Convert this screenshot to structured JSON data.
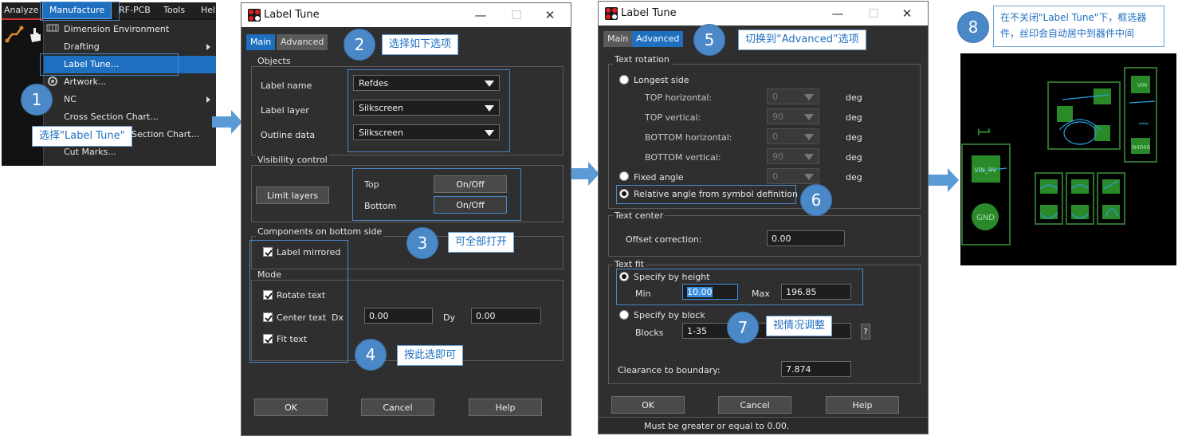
{
  "menu": {
    "bar": [
      "Analyze",
      "Manufacture",
      "RF-PCB",
      "Tools",
      "Help"
    ],
    "items": [
      {
        "label": "Dimension Environment",
        "submenu": false
      },
      {
        "label": "Drafting",
        "submenu": true
      },
      {
        "label": "Label Tune...",
        "submenu": false,
        "highlighted": true
      },
      {
        "label": "Artwork...",
        "submenu": false
      },
      {
        "label": "NC",
        "submenu": true
      },
      {
        "label": "Cross Section Chart...",
        "submenu": false
      },
      {
        "label": "Section Chart...",
        "submenu": false
      },
      {
        "label": "Cut Marks...",
        "submenu": false
      }
    ]
  },
  "callouts": [
    {
      "num": "1",
      "text": "选择\"Label Tune\""
    },
    {
      "num": "2",
      "text": "选择如下选项"
    },
    {
      "num": "3",
      "text": "可全部打开"
    },
    {
      "num": "4",
      "text": "按此选即可"
    },
    {
      "num": "5",
      "text": "切换到“Advanced”选项"
    },
    {
      "num": "6",
      "text": ""
    },
    {
      "num": "7",
      "text": "视情况调整"
    },
    {
      "num": "8",
      "text": "在不关闭\"Label Tune\"下，框选器件，丝印会自动居中到器件中间"
    }
  ],
  "dialog_main": {
    "title": "Label Tune",
    "tabs": [
      "Main",
      "Advanced"
    ],
    "objects": {
      "group": "Objects",
      "label_name": "Label name",
      "label_name_value": "Refdes",
      "label_layer": "Label layer",
      "label_layer_value": "Silkscreen",
      "outline_data": "Outline data",
      "outline_data_value": "Silkscreen"
    },
    "visibility": {
      "group": "Visibility control",
      "limit_layers": "Limit layers",
      "top": "Top",
      "bottom": "Bottom",
      "onoff": "On/Off"
    },
    "bottom_side": {
      "group": "Components on bottom side",
      "label_mirrored": "Label mirrored"
    },
    "mode": {
      "group": "Mode",
      "rotate_text": "Rotate text",
      "center_text": "Center text",
      "dx": "Dx",
      "dx_value": "0.00",
      "dy": "Dy",
      "dy_value": "0.00",
      "fit_text": "Fit text"
    },
    "buttons": {
      "ok": "OK",
      "cancel": "Cancel",
      "help": "Help"
    }
  },
  "dialog_adv": {
    "title": "Label Tune",
    "tabs": [
      "Main",
      "Advanced"
    ],
    "rotation": {
      "group": "Text rotation",
      "longest_side": "Longest side",
      "rows": [
        {
          "label": "TOP horizontal:",
          "value": "0",
          "unit": "deg"
        },
        {
          "label": "TOP vertical:",
          "value": "90",
          "unit": "deg"
        },
        {
          "label": "BOTTOM horizontal:",
          "value": "0",
          "unit": "deg"
        },
        {
          "label": "BOTTOM vertical:",
          "value": "90",
          "unit": "deg"
        }
      ],
      "fixed_angle": "Fixed angle",
      "fixed_value": "0",
      "fixed_unit": "deg",
      "relative": "Relative angle from symbol definition"
    },
    "center": {
      "group": "Text center",
      "offset": "Offset correction:",
      "offset_value": "0.00"
    },
    "fit": {
      "group": "Text fit",
      "by_height": "Specify by height",
      "min": "Min",
      "min_value": "10.00",
      "max": "Max",
      "max_value": "196.85",
      "by_block": "Specify by block",
      "blocks": "Blocks",
      "blocks_value": "1-35",
      "question": "?",
      "clearance": "Clearance to boundary:",
      "clearance_value": "7.874"
    },
    "buttons": {
      "ok": "OK",
      "cancel": "Cancel",
      "help": "Help"
    },
    "status": "Must be greater or equal to 0.00."
  },
  "pcb": {
    "labels": {
      "one": "1",
      "vin": "VIN",
      "vin9v": "VIN_9V",
      "gnd": "GND",
      "n4046": "N4046"
    }
  },
  "colors": {
    "accent": "#1f6fc0",
    "callout": "#4a88c7",
    "dialog_bg": "#2f2f2f",
    "pcb_green": "#2a8a2a",
    "silk": "#2aa0e0"
  }
}
